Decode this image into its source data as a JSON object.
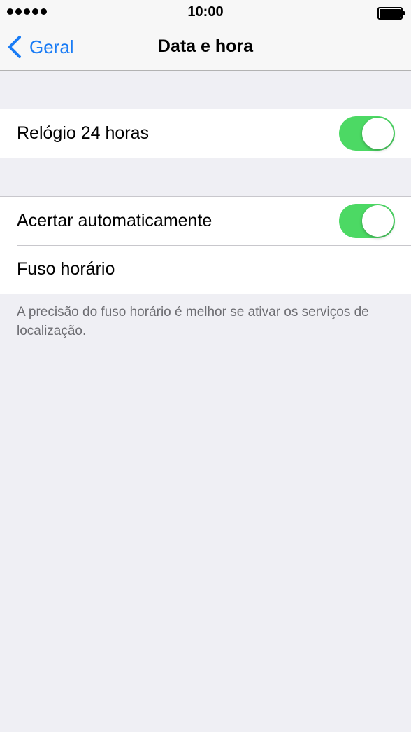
{
  "status_bar": {
    "time": "10:00",
    "signal_bars": 5,
    "battery_level": 1.0
  },
  "nav": {
    "back_label": "Geral",
    "title": "Data e hora",
    "accent_color": "#1a7cf5"
  },
  "settings": {
    "clock_24h": {
      "label": "Relógio 24 horas",
      "enabled": true
    },
    "set_automatically": {
      "label": "Acertar automaticamente",
      "enabled": true
    },
    "time_zone": {
      "label": "Fuso horário"
    }
  },
  "footer_note": "A precisão do fuso horário é melhor se ativar os serviços de localização.",
  "colors": {
    "toggle_on": "#4cd964",
    "background": "#efeff4"
  }
}
